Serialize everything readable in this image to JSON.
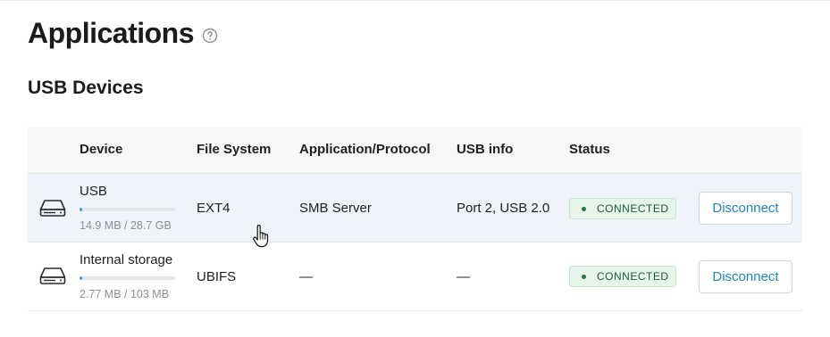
{
  "header": {
    "title": "Applications",
    "help_icon": "help-circle-icon"
  },
  "section": {
    "title": "USB Devices"
  },
  "table": {
    "columns": [
      "Device",
      "File System",
      "Application/Protocol",
      "USB info",
      "Status"
    ],
    "rows": [
      {
        "icon": "hard-drive-icon",
        "name": "USB",
        "usage_fraction": 0.0005,
        "usage_text": "14.9 MB / 28.7 GB",
        "file_system": "EXT4",
        "protocol": "SMB Server",
        "usb_info": "Port 2, USB 2.0",
        "status": "CONNECTED",
        "action": "Disconnect",
        "hovered": true
      },
      {
        "icon": "hard-drive-icon",
        "name": "Internal storage",
        "usage_fraction": 0.027,
        "usage_text": "2.77 MB / 103 MB",
        "file_system": "UBIFS",
        "protocol": "—",
        "usb_info": "—",
        "status": "CONNECTED",
        "action": "Disconnect",
        "hovered": false
      }
    ]
  },
  "colors": {
    "accent": "#1f87b8",
    "status_bg": "#e6f4ea",
    "status_text": "#1e5a30",
    "row_highlight": "#eef4fa",
    "usage_fill": "#3b9fd8"
  },
  "cursor": "hand-pointer-icon"
}
